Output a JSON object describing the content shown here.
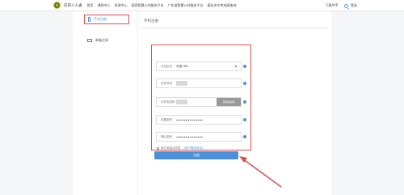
{
  "header": {
    "brand": "庆邦人人通",
    "nav": [
      "首页",
      "课程中心",
      "资源中心",
      "国家智慧公共服务平台",
      "广东省智慧公共服务平台",
      "遵化市中考成绩查询"
    ],
    "download": "下载APP",
    "login": "登录"
  },
  "sidebar": {
    "items": [
      {
        "label": "手机注册",
        "active": true,
        "icon": "phone-icon"
      },
      {
        "label": "邮箱注册",
        "active": false,
        "icon": "mail-icon"
      }
    ]
  },
  "main": {
    "title": "手机注册",
    "form": {
      "region": {
        "label": "手机区号",
        "value": "中国+86"
      },
      "phone": {
        "label": "手机号码",
        "value": ""
      },
      "code": {
        "label": "手机验证码",
        "value": "",
        "button": "获取验证码"
      },
      "password": {
        "label": "设置密码",
        "value": "••••••••••••••"
      },
      "confirm": {
        "label": "确认密码",
        "value": "••••••••••••••"
      }
    },
    "agree": {
      "text": "我已阅读并同意",
      "link": "《用户服务协议》"
    },
    "register_label": "注册"
  },
  "colors": {
    "accent": "#4a90d9",
    "highlight": "#e05050"
  }
}
